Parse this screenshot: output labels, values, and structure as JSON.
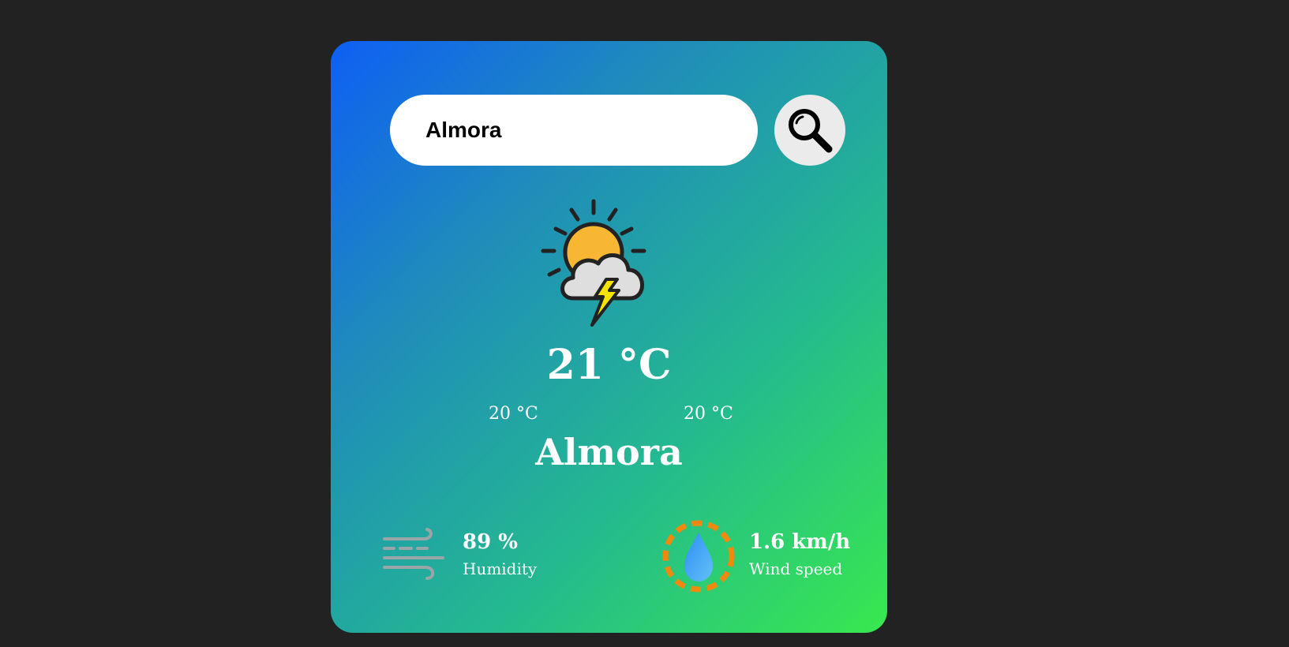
{
  "search": {
    "value": "Almora",
    "placeholder": "",
    "button_icon": "magnifier-icon"
  },
  "weather": {
    "icon": "thunderstorm-partly-sunny-icon",
    "temperature": "21 °C",
    "temp_min": "20 °C",
    "temp_max": "20 °C",
    "city": "Almora"
  },
  "details": {
    "humidity": {
      "icon": "wind-icon",
      "value": "89 %",
      "label": "Humidity"
    },
    "wind": {
      "icon": "water-drop-icon",
      "value": "1.6 km/h",
      "label": "Wind speed"
    }
  },
  "colors": {
    "page_background": "#222222",
    "gradient_start": "#0e5ff4",
    "gradient_end": "#38e84e",
    "sun": "#f7b733",
    "drop": "#3aa0f5",
    "ring": "#f0890e"
  }
}
